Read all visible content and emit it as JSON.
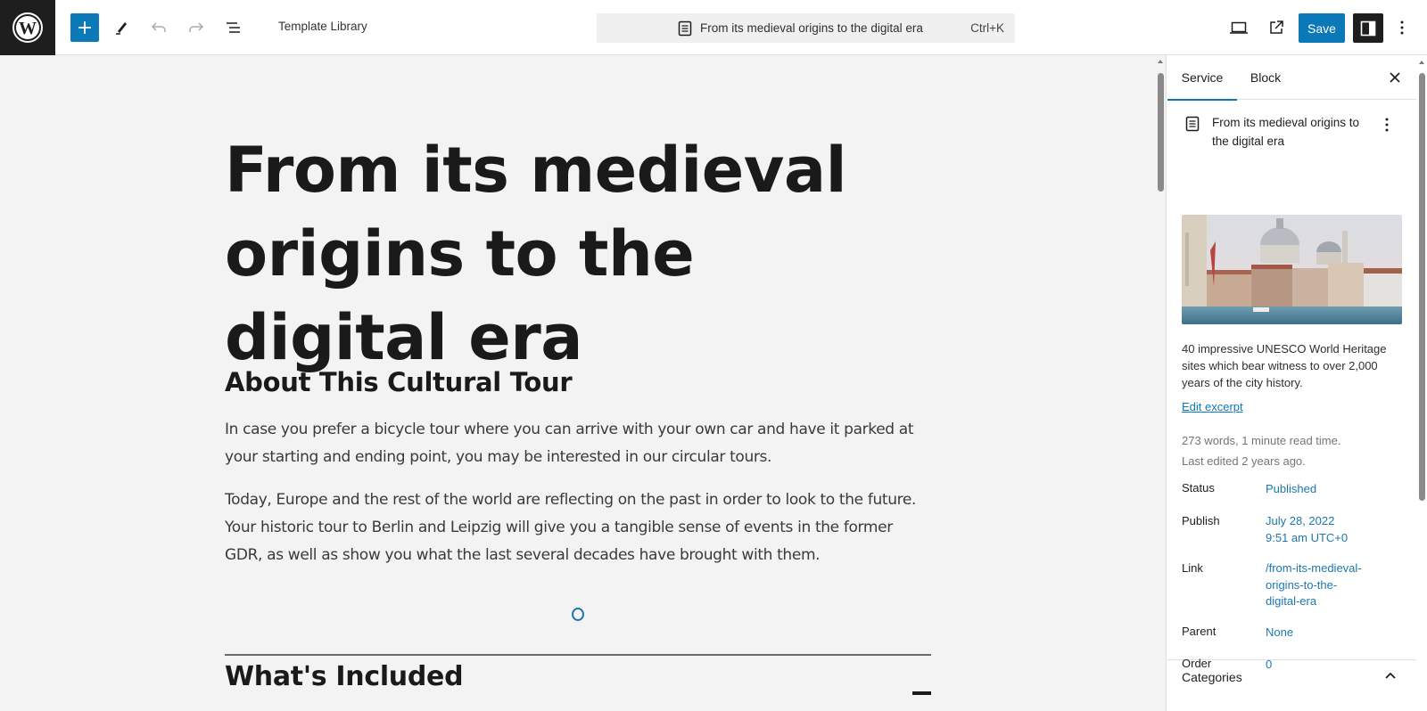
{
  "topbar": {
    "logo": "wordpress-logo",
    "tools": {
      "add_block": "plus-icon",
      "tools": "pencil-icon",
      "undo": "undo-icon",
      "redo": "redo-icon",
      "document_overview": "list-view-icon"
    },
    "title": "Template Library",
    "command_bar": {
      "icon": "document-icon",
      "title": "From its medieval origins to the digital era",
      "shortcut": "Ctrl+K"
    },
    "view_icon": "desktop-icon",
    "view_post_icon": "external-link-icon",
    "save_label": "Save",
    "settings_icon": "sidebar-toggle-icon",
    "options_icon": "more-vertical-icon"
  },
  "editor": {
    "post_title": "From its medieval origins to the digital era",
    "heading_about": "About This Cultural Tour",
    "paragraphs": [
      "In case you prefer a bicycle tour where you can arrive with your own car and have it parked at your starting and ending point, you may be interested in our circular tours.",
      "Today, Europe and the rest of the world are reflecting on the past in order to look to the future. Your historic tour to Berlin and Leipzig will give you a tangible sense of events in the former GDR, as well as show you what the last several decades have brought with them."
    ],
    "loading_indicator": "spinner-icon",
    "heading_included": "What's Included",
    "accordion_icon": "minus-icon"
  },
  "sidebar": {
    "tabs": [
      {
        "label": "Service",
        "active": true
      },
      {
        "label": "Block",
        "active": false
      }
    ],
    "close_icon": "close-icon",
    "summary": {
      "icon": "document-icon",
      "title": "From its medieval origins to the digital era",
      "featured_image_alt": "Venice Grand Canal with Santa Maria della Salute",
      "excerpt": "40 impressive UNESCO World Heritage sites which bear witness to over 2,000 years of the city history.",
      "edit_excerpt": "Edit excerpt",
      "word_count": "273 words, 1 minute read time.",
      "last_edited": "Last edited 2 years ago."
    },
    "rows": [
      {
        "label": "Status",
        "value": "Published"
      },
      {
        "label": "Publish",
        "value_line1": "July 28, 2022",
        "value_line2": "9:51 am UTC+0"
      },
      {
        "label": "Link",
        "value": "/from-its-medieval-origins-to-the-digital-era"
      },
      {
        "label": "Parent",
        "value": "None"
      },
      {
        "label": "Order",
        "value": "0"
      }
    ],
    "categories_label": "Categories"
  },
  "colors": {
    "accent": "#0b78b8",
    "link": "#1d77ac",
    "dark": "#1e1e1e",
    "canvas_bg": "#f3f3f3"
  }
}
